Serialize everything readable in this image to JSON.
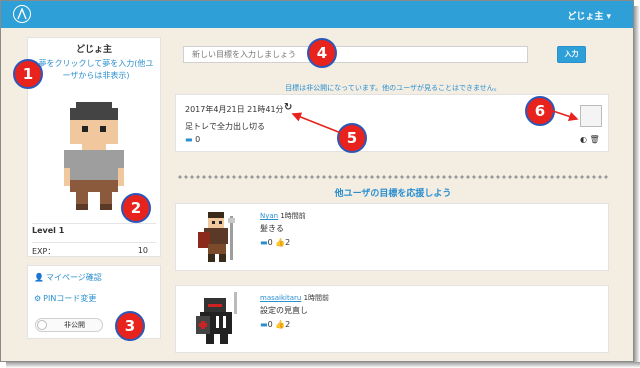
{
  "header": {
    "user_menu": "どじょ主 ▾"
  },
  "profile": {
    "name": "どじょ主",
    "dream_link": "夢をクリックして夢を入力(他ユーザからは非表示)",
    "level": "Level 1",
    "exp_label": "EXP：",
    "exp_value": "10"
  },
  "menu": {
    "mypage": "マイページ確認",
    "pin": "PINコード変更",
    "toggle_label": "非公開"
  },
  "goal_form": {
    "placeholder": "新しい目標を入力しましょう",
    "submit": "入力",
    "notice": "目標は非公開になっています。他のユーザが見ることはできません。"
  },
  "my_goal": {
    "date": "2017年4月21日 21時41分",
    "title": "足トレで全力出し切る",
    "comments": "0"
  },
  "section_title": "他ユーザの目標を応援しよう",
  "feed": [
    {
      "user": "Nyan",
      "time": "1時間前",
      "text": "髪きる",
      "comments": "0",
      "likes": "2"
    },
    {
      "user": "masaikitaru",
      "time": "1時間前",
      "text": "設定の見直し",
      "comments": "0",
      "likes": "2"
    }
  ],
  "annotations": [
    "1",
    "2",
    "3",
    "4",
    "5",
    "6"
  ],
  "colors": {
    "navbar": "#2f9fd8",
    "link": "#2a8fd0",
    "badge": "#e8221c",
    "badge_border": "#2b58b8",
    "background": "#f3ede2"
  }
}
